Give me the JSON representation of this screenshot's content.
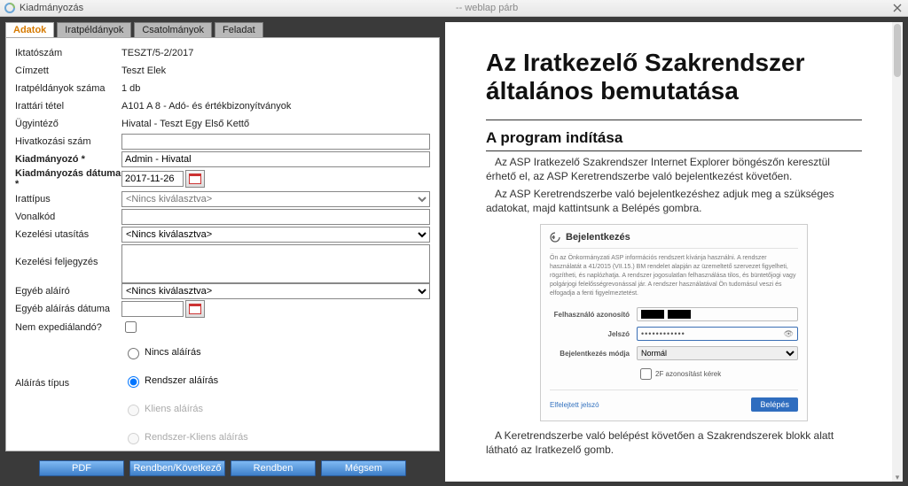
{
  "window": {
    "title": "Kiadmányozás",
    "subtitle": "-- weblap párb"
  },
  "tabs": [
    "Adatok",
    "Iratpéldányok",
    "Csatolmányok",
    "Feladat"
  ],
  "info": {
    "iktatoszam_label": "Iktatószám",
    "iktatoszam_value": "TESZT/5-2/2017",
    "cimzett_label": "Címzett",
    "cimzett_value": "Teszt Elek",
    "iratpeldanyok_label": "Iratpéldányok száma",
    "iratpeldanyok_value": "1 db",
    "irattari_label": "Irattári tétel",
    "irattari_value": "A101 A 8 - Adó- és értékbizonyítványok",
    "ugyintezo_label": "Ügyintéző",
    "ugyintezo_value": "Hivatal - Teszt Egy Első Kettő"
  },
  "form": {
    "hivatkozasi_label": "Hivatkozási szám",
    "hivatkozasi_value": "",
    "kiadmanyozo_label": "Kiadmányozó *",
    "kiadmanyozo_value": "Admin - Hivatal",
    "kiad_datum_label": "Kiadmányozás dátuma *",
    "kiad_datum_value": "2017-11-26",
    "irattipus_label": "Irattípus",
    "irattipus_placeholder": "<Nincs kiválasztva>",
    "vonalkod_label": "Vonalkód",
    "vonalkod_value": "",
    "kezelesi_label": "Kezelési utasítás",
    "kezelesi_placeholder": "<Nincs kiválasztva>",
    "feljegyzes_label": "Kezelési feljegyzés",
    "feljegyzes_value": "",
    "egyeb_alairo_label": "Egyéb aláíró",
    "egyeb_alairo_placeholder": "<Nincs kiválasztva>",
    "egyeb_datum_label": "Egyéb aláírás dátuma",
    "egyeb_datum_value": "",
    "nem_exped_label": "Nem expediálandó?",
    "alairas_tipus_label": "Aláírás típus",
    "radio": {
      "nincs": "Nincs aláírás",
      "rendszer": "Rendszer aláírás",
      "kliens": "Kliens aláírás",
      "rendszer_kliens": "Rendszer-Kliens aláírás"
    }
  },
  "buttons": {
    "pdf": "PDF",
    "rendben_kov": "Rendben/Következő",
    "rendben": "Rendben",
    "megsem": "Mégsem"
  },
  "doc": {
    "h1a": "Az Iratkezelő Szakrendszer",
    "h1b": "általános bemutatása",
    "h2": "A program indítása",
    "p1": "Az ASP Iratkezelő Szakrendszer Internet Explorer böngészőn keresztül érhető el, az ASP Keretrendszerbe való bejelentkezést követően.",
    "p2": "Az ASP Keretrendszerbe való bejelentkezéshez adjuk meg a szükséges adatokat, majd kattintsunk a Belépés gombra.",
    "p3": "A Keretrendszerbe való belépést követően a Szakrendszerek blokk alatt látható az Iratkezelő gomb."
  },
  "login": {
    "title": "Bejelentkezés",
    "desc": "Ön az Önkormányzati ASP információs rendszert kívánja használni. A rendszer használatát a 41/2015 (VII.15.) BM rendelet alapján az üzemeltető szervezet figyelheti, rögzítheti, és naplózhatja. A rendszer jogosulatlan felhasználása tilos, és büntetőjogi vagy polgárjogi felelősségrevonással jár. A rendszer használatával Ön tudomásul veszi és elfogadja a fenti figyelmeztetést.",
    "user_label": "Felhasználó azonosító",
    "pass_label": "Jelszó",
    "pass_value": "••••••••••••",
    "mode_label": "Bejelentkezés módja",
    "mode_value": "Normál",
    "twofa_label": "2F azonosítást kérek",
    "forgot": "Elfelejtett jelszó",
    "submit": "Belépés"
  }
}
